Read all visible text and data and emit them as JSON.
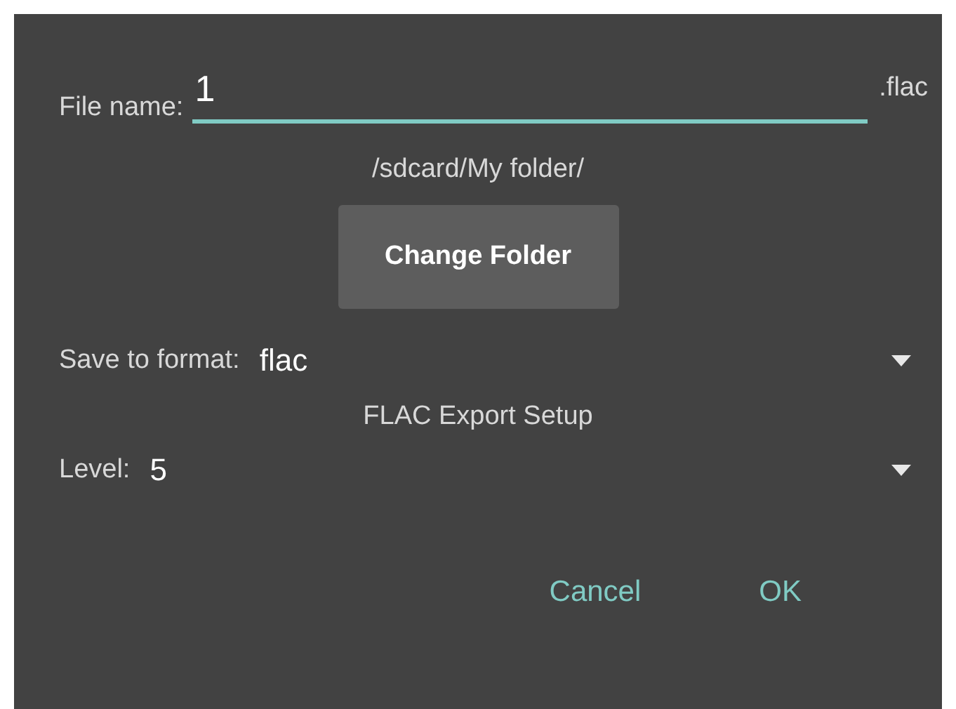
{
  "file_name": {
    "label": "File name:",
    "value": "1",
    "extension": ".flac"
  },
  "folder": {
    "path": "/sdcard/My folder/",
    "button": "Change Folder"
  },
  "format": {
    "label": "Save to format:",
    "value": "flac"
  },
  "setup_title": "FLAC Export Setup",
  "level": {
    "label": "Level:",
    "value": "5"
  },
  "buttons": [
    {
      "label": "Cancel"
    },
    {
      "label": "OK"
    }
  ]
}
